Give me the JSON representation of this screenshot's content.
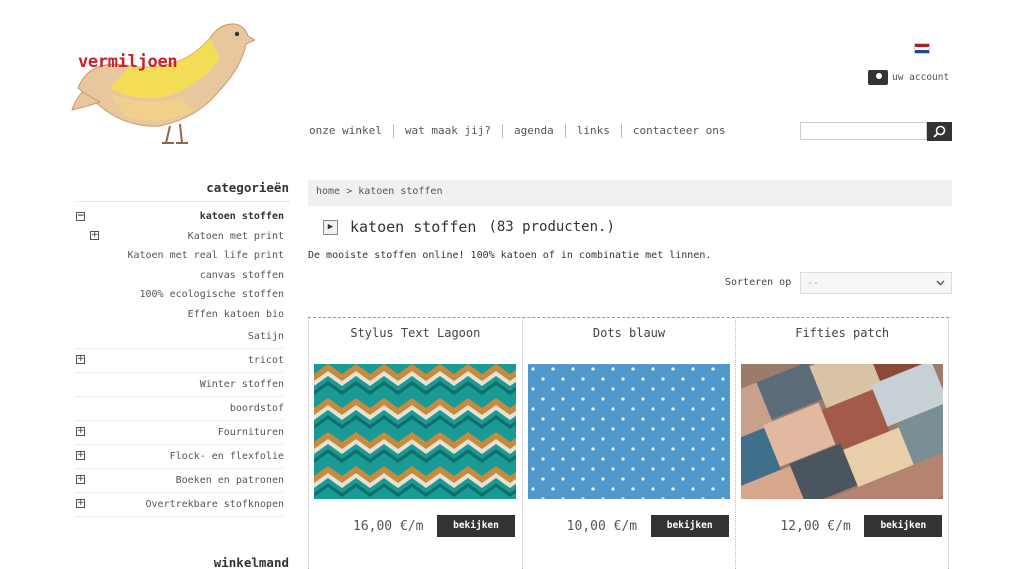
{
  "logo": {
    "text": "vermiljoen"
  },
  "header": {
    "language_flag": "dutch-flag",
    "account_label": "uw account",
    "nav": [
      "onze winkel",
      "wat maak jij?",
      "agenda",
      "links",
      "contacteer ons"
    ],
    "search": {
      "placeholder": "",
      "button_icon": "search-icon"
    }
  },
  "sidebar": {
    "title": "categorieën",
    "items": [
      {
        "label": "katoen stoffen",
        "bold": true,
        "toggle": "⊟"
      },
      {
        "label": "Katoen met print",
        "toggle": "⊞"
      },
      {
        "label": "Katoen met real life print"
      },
      {
        "label": "canvas stoffen"
      },
      {
        "label": "100% ecologische stoffen"
      },
      {
        "label": "Effen katoen bio"
      },
      {
        "label": "Satijn"
      },
      {
        "label": "tricot",
        "toggle": "⊞"
      },
      {
        "label": "Winter stoffen"
      },
      {
        "label": "boordstof"
      },
      {
        "label": "Fournituren",
        "toggle": "⊞"
      },
      {
        "label": "Flock- en flexfolie",
        "toggle": "⊞"
      },
      {
        "label": "Boeken en patronen",
        "toggle": "⊞"
      },
      {
        "label": "Overtrekbare stofknopen",
        "toggle": "⊞"
      }
    ],
    "cart_title": "winkelmand"
  },
  "main": {
    "breadcrumb": {
      "home": "home",
      "separator": ">",
      "current": "katoen stoffen"
    },
    "title": "katoen stoffen",
    "count": "(83 producten.)",
    "description": "De mooiste stoffen online! 100% katoen of in combinatie met linnen.",
    "sort": {
      "label": "Sorteren op",
      "value": "--"
    },
    "products": [
      {
        "name": "Stylus Text Lagoon",
        "price": "16,00 €/m",
        "button": "bekijken"
      },
      {
        "name": "Dots blauw",
        "price": "10,00 €/m",
        "button": "bekijken"
      },
      {
        "name": "Fifties patch",
        "price": "12,00 €/m",
        "button": "bekijken"
      }
    ]
  },
  "colors": {
    "accent": "#333333",
    "logo_red": "#c8202a",
    "breadcrumb_bg": "#f0f0f0"
  }
}
